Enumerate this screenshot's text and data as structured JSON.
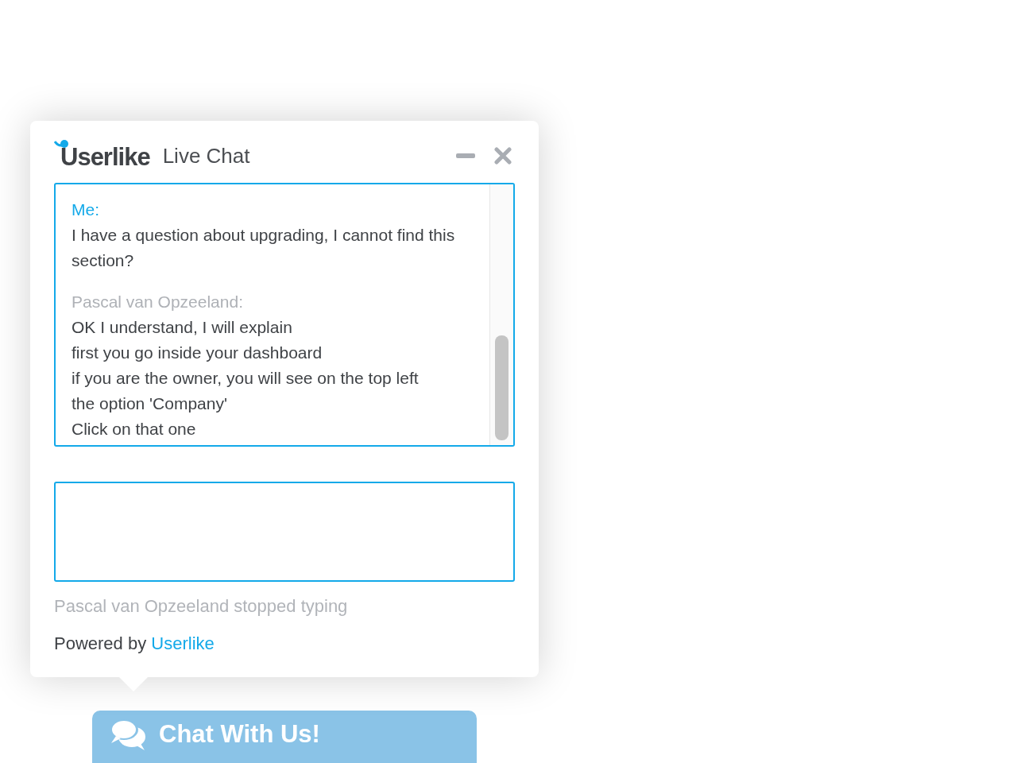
{
  "header": {
    "logo": "Userlike",
    "title": "Live Chat"
  },
  "messages": [
    {
      "kind": "me",
      "author": "Me:",
      "lines": [
        "I have a question about upgrading, I cannot find this section?"
      ]
    },
    {
      "kind": "agent",
      "author": "Pascal van Opzeeland:",
      "lines": [
        "OK I understand, I will explain",
        "first you go inside your dashboard",
        "if you are the owner, you will see on the top left",
        "the option 'Company'",
        "Click on that one"
      ]
    }
  ],
  "status": "Pascal van Opzeeland stopped typing",
  "footer": {
    "text": "Powered by",
    "link": "Userlike"
  },
  "launcher": {
    "label": "Chat With Us!"
  }
}
